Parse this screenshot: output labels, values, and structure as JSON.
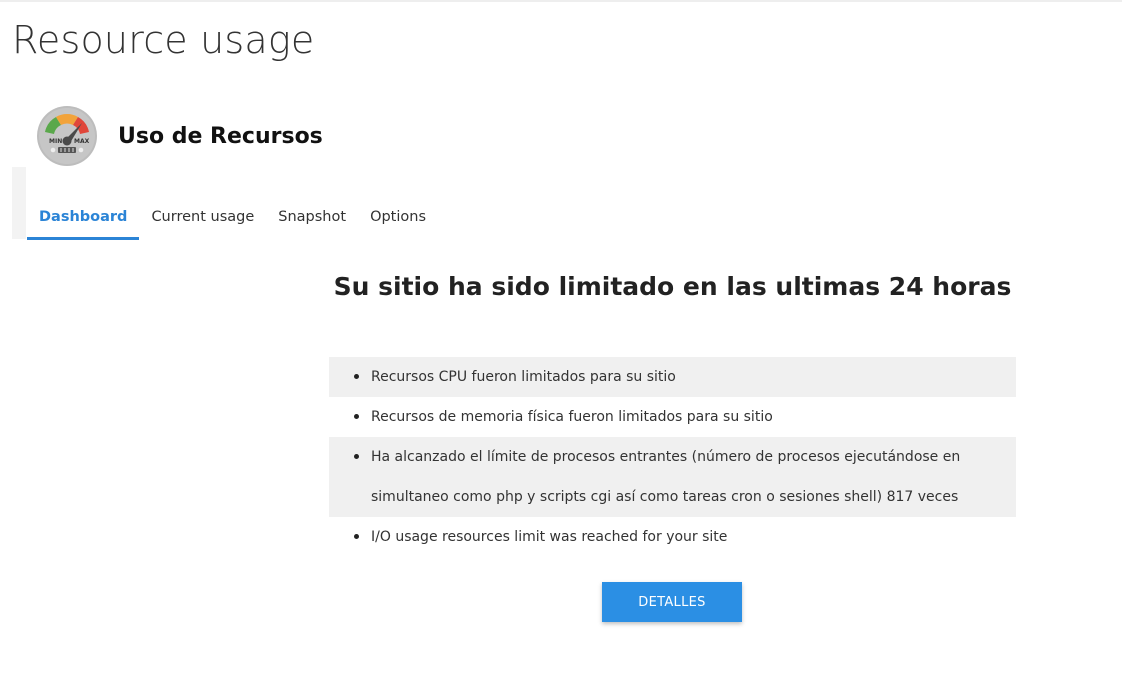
{
  "page": {
    "title": "Resource usage"
  },
  "plugin": {
    "title": "Uso de Recursos",
    "icon": "gauge-icon",
    "gauge_min_label": "MIN",
    "gauge_max_label": "MAX"
  },
  "tabs": [
    {
      "label": "Dashboard",
      "active": true
    },
    {
      "label": "Current usage",
      "active": false
    },
    {
      "label": "Snapshot",
      "active": false
    },
    {
      "label": "Options",
      "active": false
    }
  ],
  "main": {
    "heading": "Su sitio ha sido limitado en las ultimas 24 horas",
    "notices": [
      "Recursos CPU fueron limitados para su sitio",
      "Recursos de memoria física fueron limitados para su sitio",
      "Ha alcanzado el límite de procesos entrantes (número de procesos ejecutándose en simultaneo como php y scripts cgi así como tareas cron o sesiones shell) 817 veces",
      "I/O usage resources limit was reached for your site"
    ],
    "details_button": "DETALLES"
  },
  "colors": {
    "accent": "#2b84d6",
    "button": "#2b8fe4",
    "row_alt": "#f0f0f0"
  }
}
